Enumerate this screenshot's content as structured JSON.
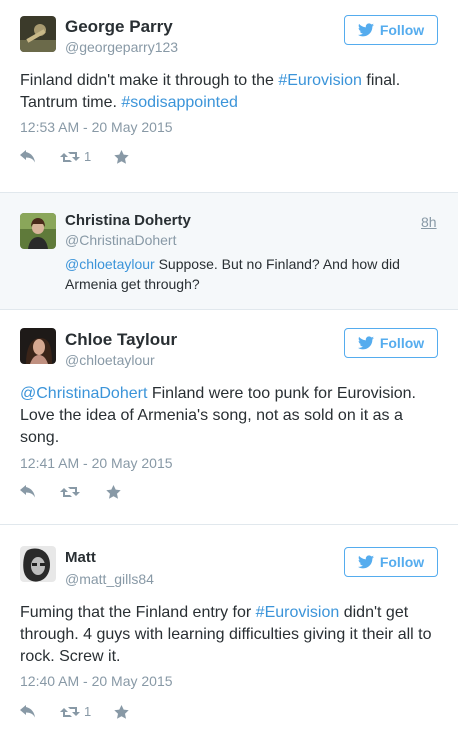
{
  "follow_label": "Follow",
  "tweets": [
    {
      "name": "George Parry",
      "handle": "@georgeparry123",
      "text_parts": [
        "Finland didn't make it through to the ",
        "#Eurovision",
        " final. Tantrum time. ",
        "#sodisappointed"
      ],
      "timestamp": "12:53 AM - 20 May 2015",
      "retweets": "1"
    },
    {
      "name": "Christina Doherty",
      "handle": "@ChristinaDohert",
      "age": "8h",
      "text_parts": [
        "@chloetaylour",
        " Suppose. But no Finland? And how did Armenia get through?"
      ]
    },
    {
      "name": "Chloe Taylour",
      "handle": "@chloetaylour",
      "text_parts": [
        "@ChristinaDohert",
        " Finland were too punk for Eurovision. Love the idea of Armenia's song, not as sold on it as a song."
      ],
      "timestamp": "12:41 AM - 20 May 2015"
    },
    {
      "name": "Matt",
      "handle": "@matt_gills84",
      "text_parts": [
        "Fuming that the Finland entry for ",
        "#Eurovision",
        " didn't get through. 4 guys with learning difficulties giving it their all to rock. Screw it."
      ],
      "timestamp": "12:40 AM - 20 May 2015",
      "retweets": "1"
    }
  ],
  "colors": {
    "link": "#3b94d9",
    "meta": "#8899a6",
    "accent": "#55acee"
  },
  "icons": {
    "bird": "twitter-bird-icon",
    "reply": "reply-icon",
    "retweet": "retweet-icon",
    "favorite": "star-icon"
  }
}
